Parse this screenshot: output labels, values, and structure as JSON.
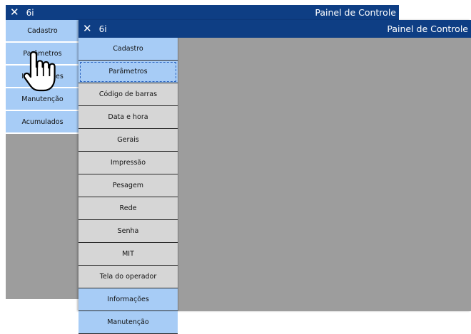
{
  "back_window": {
    "close_glyph": "✕",
    "title": "6i",
    "right_title": "Painel de Controle",
    "menu": [
      {
        "label": "Cadastro",
        "style": "blue"
      },
      {
        "label": "Parâmetros",
        "style": "blue"
      },
      {
        "label": "Informações",
        "style": "blue"
      },
      {
        "label": "Manutenção",
        "style": "blue"
      },
      {
        "label": "Acumulados",
        "style": "blue"
      }
    ]
  },
  "front_window": {
    "close_glyph": "✕",
    "title": "6i",
    "right_title": "Painel de Controle",
    "menu": [
      {
        "label": "Cadastro",
        "style": "blue"
      },
      {
        "label": "Parâmetros",
        "style": "blue",
        "selected": true
      },
      {
        "label": "Código de barras",
        "style": "gray"
      },
      {
        "label": "Data e hora",
        "style": "gray"
      },
      {
        "label": "Gerais",
        "style": "gray"
      },
      {
        "label": "Impressão",
        "style": "gray"
      },
      {
        "label": "Pesagem",
        "style": "gray"
      },
      {
        "label": "Rede",
        "style": "gray"
      },
      {
        "label": "Senha",
        "style": "gray"
      },
      {
        "label": "MIT",
        "style": "gray"
      },
      {
        "label": "Tela do operador",
        "style": "gray"
      },
      {
        "label": "Informações",
        "style": "blue"
      },
      {
        "label": "Manutenção",
        "style": "blue"
      }
    ]
  },
  "colors": {
    "titlebar": "#0e3e84",
    "blue_button": "#a7ccf6",
    "gray_button": "#d6d6d6",
    "background": "#9d9d9d"
  },
  "cursor": {
    "icon": "hand-pointer-icon"
  }
}
